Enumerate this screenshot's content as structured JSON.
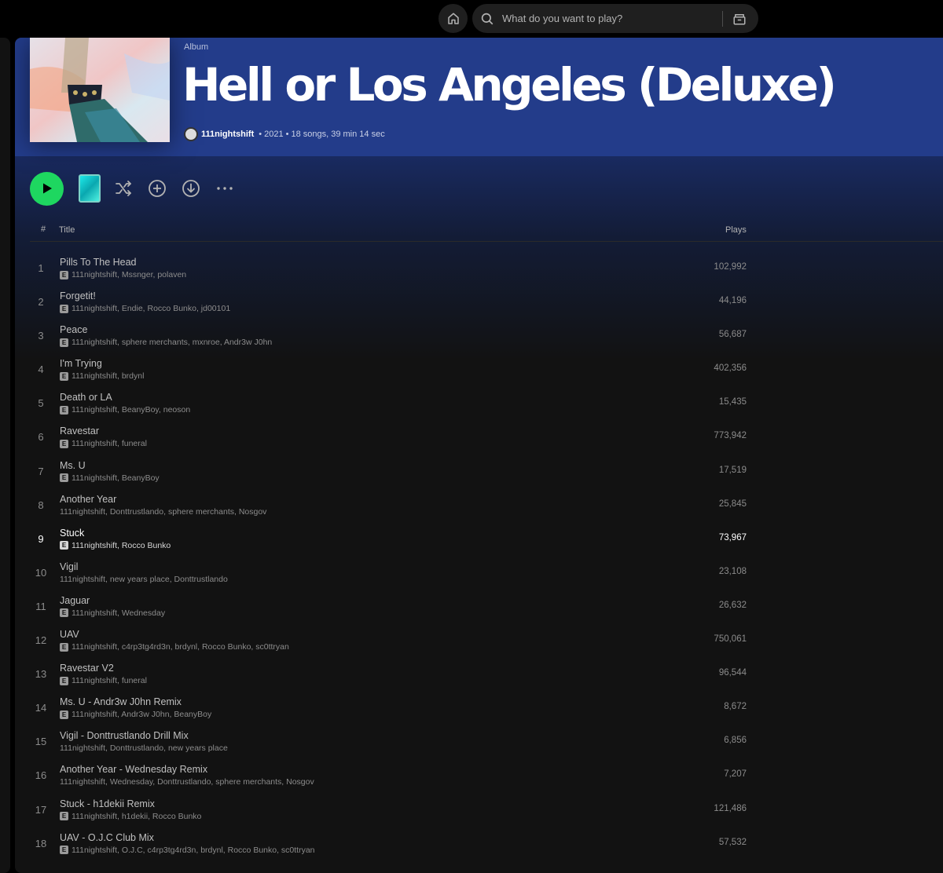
{
  "search": {
    "placeholder": "What do you want to play?"
  },
  "album": {
    "type_label": "Album",
    "title": "Hell or Los Angeles (Deluxe)",
    "artist": "111nightshift",
    "year": "2021",
    "stats": "18 songs, 39 min 14 sec",
    "separator": "•"
  },
  "colors": {
    "hero": "#233c8a",
    "play_button": "#1ed760",
    "background": "#121212"
  },
  "table": {
    "headers": {
      "number": "#",
      "title": "Title",
      "plays": "Plays"
    },
    "rows": [
      {
        "num": "1",
        "title": "Pills To The Head",
        "artists": "111nightshift, Mssnger, polaven",
        "explicit": true,
        "plays": "102,992"
      },
      {
        "num": "2",
        "title": "Forgetit!",
        "artists": "111nightshift, Endie, Rocco Bunko, jd00101",
        "explicit": true,
        "plays": "44,196"
      },
      {
        "num": "3",
        "title": "Peace",
        "artists": "111nightshift, sphere merchants, mxnroe, Andr3w J0hn",
        "explicit": true,
        "plays": "56,687"
      },
      {
        "num": "4",
        "title": "I'm Trying",
        "artists": "111nightshift, brdynl",
        "explicit": true,
        "plays": "402,356"
      },
      {
        "num": "5",
        "title": "Death or LA",
        "artists": "111nightshift, BeanyBoy, neoson",
        "explicit": true,
        "plays": "15,435"
      },
      {
        "num": "6",
        "title": "Ravestar",
        "artists": "111nightshift, funeral",
        "explicit": true,
        "plays": "773,942"
      },
      {
        "num": "7",
        "title": "Ms. U",
        "artists": "111nightshift, BeanyBoy",
        "explicit": true,
        "plays": "17,519"
      },
      {
        "num": "8",
        "title": "Another Year",
        "artists": "111nightshift, Donttrustlando, sphere merchants, Nosgov",
        "explicit": false,
        "plays": "25,845"
      },
      {
        "num": "9",
        "title": "Stuck",
        "artists": "111nightshift, Rocco Bunko",
        "explicit": true,
        "plays": "73,967",
        "active": true
      },
      {
        "num": "10",
        "title": "Vigil",
        "artists": "111nightshift, new years place, Donttrustlando",
        "explicit": false,
        "plays": "23,108"
      },
      {
        "num": "11",
        "title": "Jaguar",
        "artists": "111nightshift, Wednesday",
        "explicit": true,
        "plays": "26,632"
      },
      {
        "num": "12",
        "title": "UAV",
        "artists": "111nightshift, c4rp3tg4rd3n, brdynl, Rocco Bunko, sc0ttryan",
        "explicit": true,
        "plays": "750,061"
      },
      {
        "num": "13",
        "title": "Ravestar V2",
        "artists": "111nightshift, funeral",
        "explicit": true,
        "plays": "96,544"
      },
      {
        "num": "14",
        "title": "Ms. U - Andr3w J0hn Remix",
        "artists": "111nightshift, Andr3w J0hn, BeanyBoy",
        "explicit": true,
        "plays": "8,672"
      },
      {
        "num": "15",
        "title": "Vigil - Donttrustlando Drill Mix",
        "artists": "111nightshift, Donttrustlando, new years place",
        "explicit": false,
        "plays": "6,856"
      },
      {
        "num": "16",
        "title": "Another Year - Wednesday Remix",
        "artists": "111nightshift, Wednesday, Donttrustlando, sphere merchants, Nosgov",
        "explicit": false,
        "plays": "7,207"
      },
      {
        "num": "17",
        "title": "Stuck - h1dekii Remix",
        "artists": "111nightshift, h1dekii, Rocco Bunko",
        "explicit": true,
        "plays": "121,486"
      },
      {
        "num": "18",
        "title": "UAV - O.J.C Club Mix",
        "artists": "111nightshift, O.J.C, c4rp3tg4rd3n, brdynl, Rocco Bunko, sc0ttryan",
        "explicit": true,
        "plays": "57,532"
      }
    ]
  }
}
